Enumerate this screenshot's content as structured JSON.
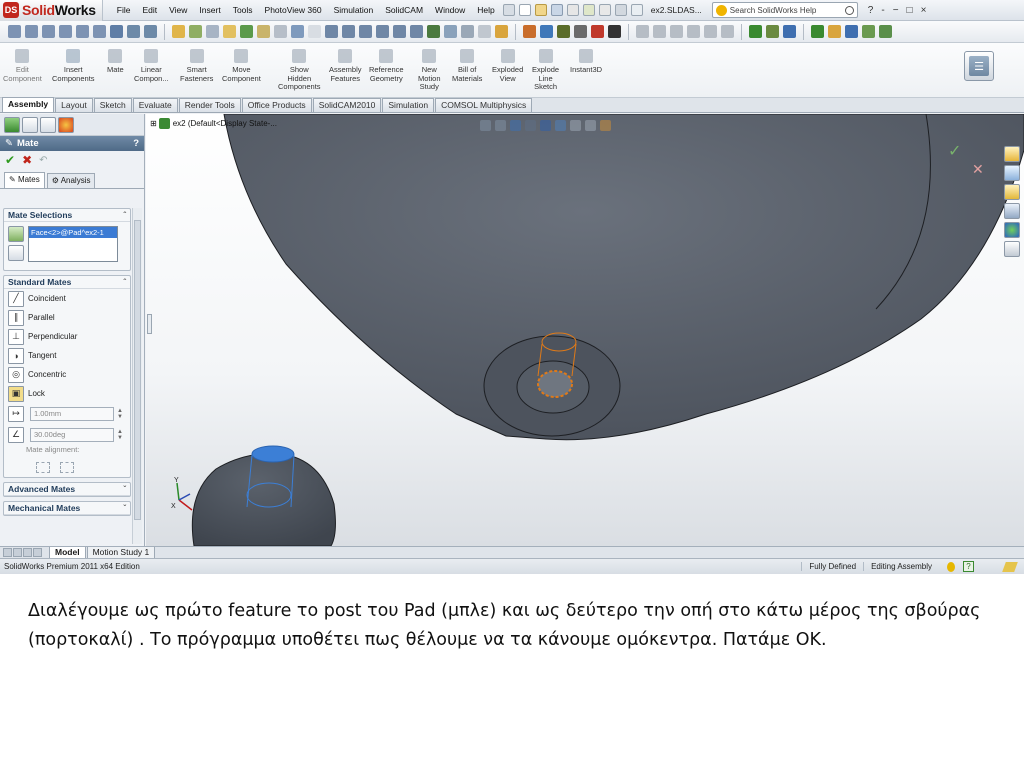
{
  "app": {
    "logo_prefix": "Solid",
    "logo_suffix": "Works",
    "doc_name": "ex2.SLDAS...",
    "help_search_placeholder": "Search SolidWorks Help",
    "menu": [
      "File",
      "Edit",
      "View",
      "Insert",
      "Tools",
      "PhotoView 360",
      "Simulation",
      "SolidCAM",
      "Window",
      "Help"
    ],
    "window_controls": [
      "?",
      "-",
      "−",
      "□",
      "×"
    ]
  },
  "command_manager": {
    "items": [
      {
        "label": "Edit\nComponent",
        "disabled": true
      },
      {
        "label": "Insert\nComponents",
        "disabled": false
      },
      {
        "label": "Mate",
        "disabled": false
      },
      {
        "label": "Linear\nCompon...",
        "disabled": false
      },
      {
        "label": "Smart\nFasteners",
        "disabled": false
      },
      {
        "label": "Move\nComponent",
        "disabled": false
      },
      {
        "label": "Show\nHidden\nComponents",
        "disabled": false
      },
      {
        "label": "Assembly\nFeatures",
        "disabled": false
      },
      {
        "label": "Reference\nGeometry",
        "disabled": false
      },
      {
        "label": "New\nMotion\nStudy",
        "disabled": false
      },
      {
        "label": "Bill of\nMaterials",
        "disabled": false
      },
      {
        "label": "Exploded\nView",
        "disabled": false
      },
      {
        "label": "Explode\nLine\nSketch",
        "disabled": false
      },
      {
        "label": "Instant3D",
        "disabled": false
      }
    ]
  },
  "tabs": [
    "Assembly",
    "Layout",
    "Sketch",
    "Evaluate",
    "Render Tools",
    "Office Products",
    "SolidCAM2010",
    "Simulation",
    "COMSOL Multiphysics"
  ],
  "active_tab": "Assembly",
  "property_manager": {
    "title": "Mate",
    "help": "?",
    "subtabs": [
      "Mates",
      "Analysis"
    ],
    "mate_selections": {
      "heading": "Mate Selections",
      "selected_item": "Face<2>@Pad^ex2-1"
    },
    "standard_mates": {
      "heading": "Standard Mates",
      "items": [
        {
          "label": "Coincident",
          "icon": "coincident-icon"
        },
        {
          "label": "Parallel",
          "icon": "parallel-icon"
        },
        {
          "label": "Perpendicular",
          "icon": "perpendicular-icon"
        },
        {
          "label": "Tangent",
          "icon": "tangent-icon"
        },
        {
          "label": "Concentric",
          "icon": "concentric-icon"
        },
        {
          "label": "Lock",
          "icon": "lock-icon"
        }
      ],
      "distance_value": "1.00mm",
      "angle_value": "30.00deg",
      "mate_alignment_label": "Mate alignment:"
    },
    "advanced_mates_heading": "Advanced Mates",
    "mechanical_mates_heading": "Mechanical Mates"
  },
  "viewport": {
    "tree_root": "ex2  (Default<Display State-...",
    "colors": {
      "top_body": "#545b66",
      "bottom_body": "#4e5560",
      "selection_blue": "#3c7fd6",
      "selection_orange": "#e07a18",
      "background": "#f3f5f7"
    }
  },
  "model_tabs": [
    "Model",
    "Motion Study 1"
  ],
  "active_model_tab": "Model",
  "status": {
    "edition": "SolidWorks Premium 2011 x64 Edition",
    "state": "Fully Defined",
    "mode": "Editing Assembly"
  },
  "caption": "Διαλέγουμε ως πρώτο feature το post του Pad (μπλε) και ως δεύτερο την οπή στο κάτω μέρος της σβούρας (πορτοκαλί) . Το πρόγραμμα υποθέτει πως θέλουμε να τα κάνουμε ομόκεντρα. Πατάμε ΟΚ."
}
